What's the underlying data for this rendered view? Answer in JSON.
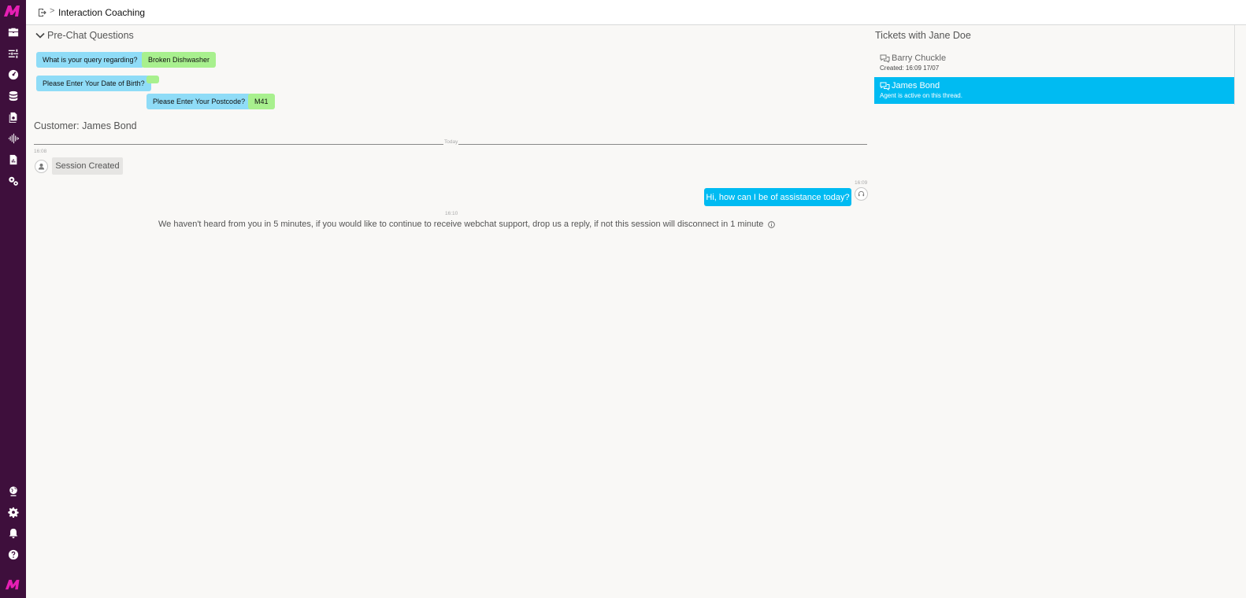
{
  "app": {
    "logo_icon": "m-logo-icon",
    "brand_color": "#3e0f3c",
    "accent_color": "#00bbf2"
  },
  "sidebar": {
    "items": [
      {
        "icon": "briefcase-icon"
      },
      {
        "icon": "sliders-icon"
      },
      {
        "icon": "dashboard-icon"
      },
      {
        "icon": "database-icon"
      },
      {
        "icon": "documents-icon"
      },
      {
        "icon": "audio-wave-icon"
      },
      {
        "icon": "report-icon"
      },
      {
        "icon": "gears-icon"
      }
    ],
    "bottom_items": [
      {
        "icon": "globe-icon"
      },
      {
        "icon": "settings-icon"
      },
      {
        "icon": "bell-icon"
      },
      {
        "icon": "help-icon"
      }
    ]
  },
  "topbar": {
    "breadcrumb_separator": ">",
    "title": "Interaction Coaching"
  },
  "prechat": {
    "title": "Pre-Chat Questions",
    "questions": [
      {
        "question": "What is your query regarding?",
        "answer": "Broken Dishwasher"
      },
      {
        "question": "Please Enter Your Date of Birth?",
        "answer": ""
      },
      {
        "question": "Please Enter Your Postcode?",
        "answer": "M41"
      }
    ]
  },
  "conversation": {
    "customer_title": "Customer: James Bond",
    "day_label": "Today",
    "messages": [
      {
        "type": "session",
        "time": "16:08",
        "text": "Session Created"
      },
      {
        "type": "agent",
        "time": "16:09",
        "text": "Hi, how can I be of assistance today?"
      },
      {
        "type": "system",
        "time": "16:10",
        "text": "We haven't heard from you in 5 minutes, if you would like to continue to receive webchat support, drop us a reply, if not this session will disconnect in 1 minute"
      }
    ]
  },
  "tickets": {
    "title": "Tickets with Jane Doe",
    "items": [
      {
        "name": "Barry Chuckle",
        "sub": "Created: 16:09 17/07",
        "active": false
      },
      {
        "name": "James Bond",
        "sub": "Agent is active on this thread.",
        "active": true
      }
    ]
  }
}
